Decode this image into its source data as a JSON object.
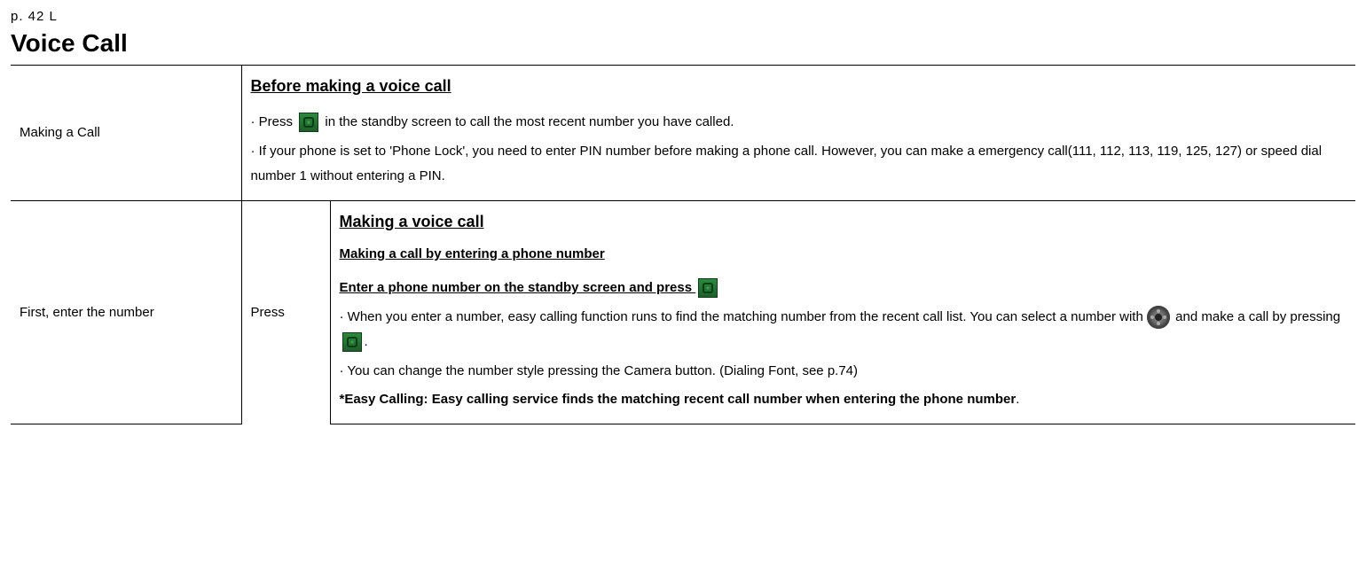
{
  "page_header": "p.  42 L",
  "title": "Voice Call",
  "row1": {
    "left": "Making a Call",
    "heading": "Before making a voice call",
    "l1a": "· Press ",
    "l1b": " in the standby screen to call the most recent number you have called.",
    "l2": "· If your phone is set to 'Phone Lock', you need to enter PIN number before making a phone call. However, you can make a emergency call(111, 112, 113, 119, 125, 127) or speed dial number 1 without entering a PIN."
  },
  "row2": {
    "left": "First, enter the number",
    "mid": "Press",
    "h1": "Making a voice call",
    "h2": "Making a call by entering a phone number",
    "h3a": "Enter a phone number on the standby screen and press ",
    "p1a": "· When you enter a number, easy calling function runs to find the matching number from the recent call list. You can select a number with ",
    "p1b": "and make a call by pressing ",
    "p1c": ".",
    "p2": " · You can change the number style pressing the Camera button. (Dialing Font, see p.74)",
    "p3": "*Easy Calling: Easy calling service finds the matching recent call number when entering the phone number",
    "p3end": "."
  }
}
